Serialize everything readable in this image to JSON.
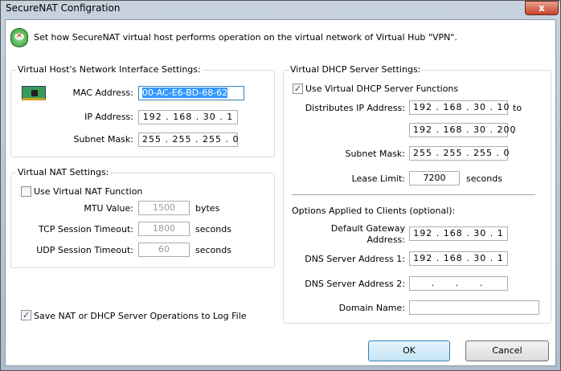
{
  "window": {
    "title": "SecureNAT Configration",
    "close": "x"
  },
  "header": {
    "description": "Set how SecureNAT virtual host performs operation on the virtual network of Virtual Hub \"VPN\"."
  },
  "host": {
    "title": "Virtual Host's Network Interface Settings:",
    "mac_label": "MAC Address:",
    "mac": "00-AC-E6-BD-68-62",
    "ip_label": "IP Address:",
    "ip": "192 . 168 . 30 . 1",
    "mask_label": "Subnet Mask:",
    "mask": "255 . 255 . 255 . 0"
  },
  "nat": {
    "title": "Virtual NAT Settings:",
    "use_label": "Use Virtual NAT Function",
    "use_checked": false,
    "mtu_label": "MTU Value:",
    "mtu": "1500",
    "mtu_unit": "bytes",
    "tcp_label": "TCP Session Timeout:",
    "tcp": "1800",
    "tcp_unit": "seconds",
    "udp_label": "UDP Session Timeout:",
    "udp": "60",
    "udp_unit": "seconds"
  },
  "log": {
    "label": "Save NAT or DHCP Server Operations to Log File",
    "checked": true
  },
  "dhcp": {
    "title": "Virtual DHCP Server Settings:",
    "use_label": "Use Virtual DHCP Server Functions",
    "use_checked": true,
    "dist_label": "Distributes IP Address:",
    "dist_start": "192 . 168 . 30 . 10",
    "to": "to",
    "dist_end": "192 . 168 . 30 . 200",
    "dot": ".",
    "mask_label": "Subnet Mask:",
    "mask": "255 . 255 . 255 . 0",
    "lease_label": "Lease Limit:",
    "lease": "7200",
    "lease_unit": "seconds",
    "options_title": "Options Applied to Clients (optional):",
    "gw_label1": "Default Gateway",
    "gw_label2": "Address:",
    "gw": "192 . 168 . 30 . 1",
    "dns1_label": "DNS Server Address 1:",
    "dns1": "192 . 168 . 30 . 1",
    "dns2_label": "DNS Server Address 2:",
    "dns2": " .   .   . ",
    "domain_label": "Domain Name:",
    "domain": ""
  },
  "buttons": {
    "ok": "OK",
    "cancel": "Cancel"
  }
}
